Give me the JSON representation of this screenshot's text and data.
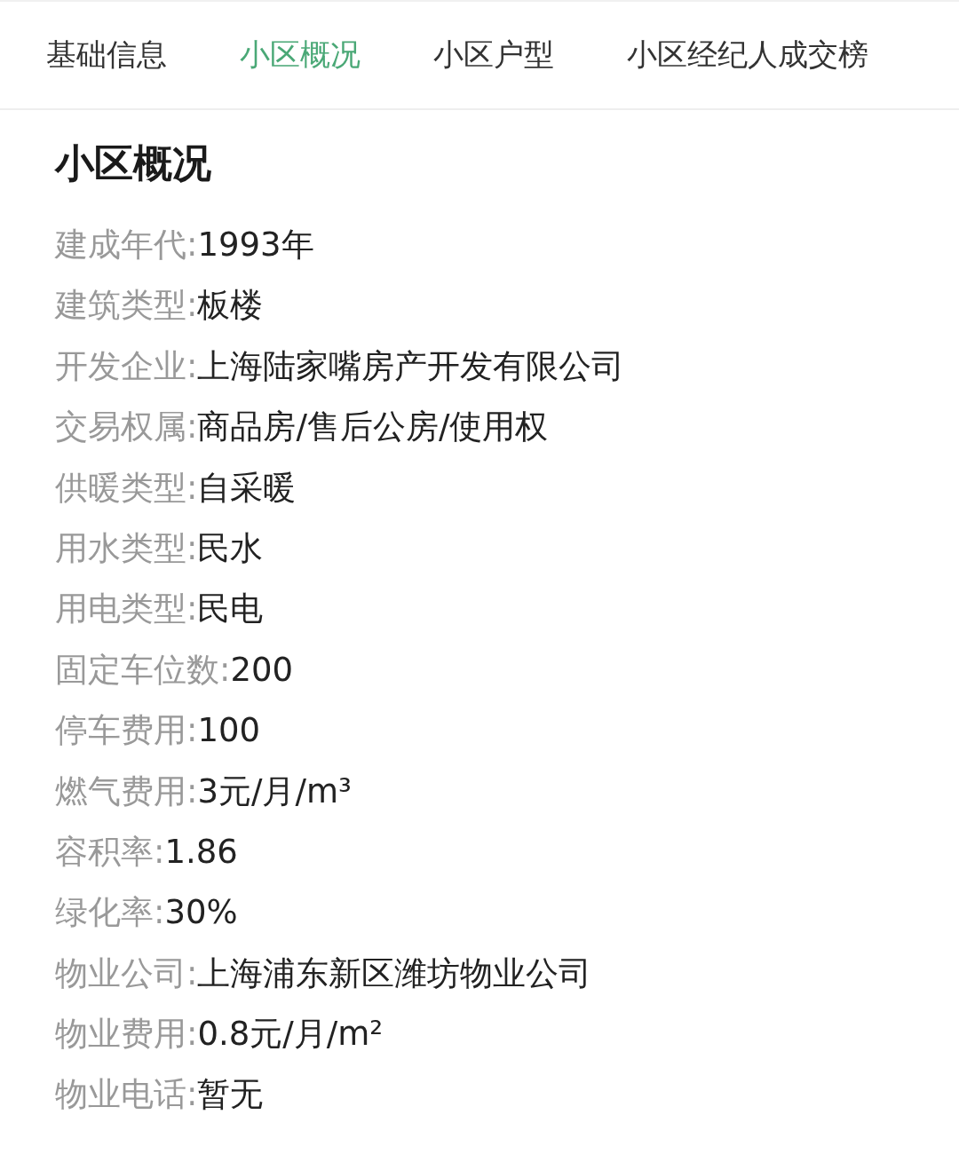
{
  "tabs": [
    {
      "label": "基础信息",
      "selected": false
    },
    {
      "label": "小区概况",
      "selected": true
    },
    {
      "label": "小区户型",
      "selected": false
    },
    {
      "label": "小区经纪人成交榜",
      "selected": false
    }
  ],
  "section": {
    "title": "小区概况",
    "rows": [
      {
        "label": "建成年代:",
        "value": "1993年"
      },
      {
        "label": "建筑类型:",
        "value": "板楼"
      },
      {
        "label": "开发企业:",
        "value": "上海陆家嘴房产开发有限公司"
      },
      {
        "label": "交易权属:",
        "value": "商品房/售后公房/使用权"
      },
      {
        "label": "供暖类型:",
        "value": "自采暖"
      },
      {
        "label": "用水类型:",
        "value": "民水"
      },
      {
        "label": "用电类型:",
        "value": "民电"
      },
      {
        "label": "固定车位数:",
        "value": "200"
      },
      {
        "label": "停车费用:",
        "value": "100"
      },
      {
        "label": "燃气费用:",
        "value": "3元/月/m³"
      },
      {
        "label": "容积率:",
        "value": "1.86"
      },
      {
        "label": "绿化率:",
        "value": "30%"
      },
      {
        "label": "物业公司:",
        "value": "上海浦东新区潍坊物业公司"
      },
      {
        "label": "物业费用:",
        "value": "0.8元/月/m²"
      },
      {
        "label": "物业电话:",
        "value": "暂无"
      }
    ]
  }
}
